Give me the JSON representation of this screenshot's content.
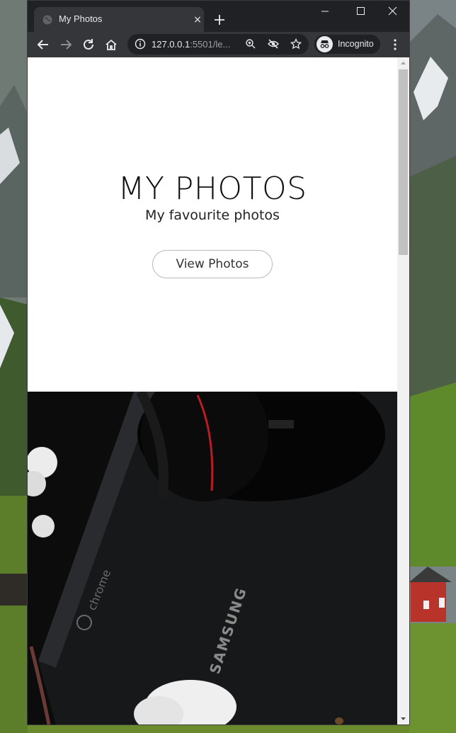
{
  "window": {
    "tab_title": "My Photos",
    "tab_close": "×",
    "new_tab": "+"
  },
  "omnibox": {
    "url_host": "127.0.0.1",
    "url_rest": ":5501/le..."
  },
  "profile": {
    "label": "Incognito"
  },
  "hero": {
    "title": "MY PHOTOS",
    "subtitle": "My favourite photos",
    "button_label": "View Photos"
  },
  "photo": {
    "chrome_text": "chrome",
    "brand_text": "SAMSUNG"
  },
  "colors": {
    "chrome_dark": "#202124",
    "chrome_toolbar": "#35363a",
    "page_bg": "#ffffff",
    "text": "#111111"
  }
}
